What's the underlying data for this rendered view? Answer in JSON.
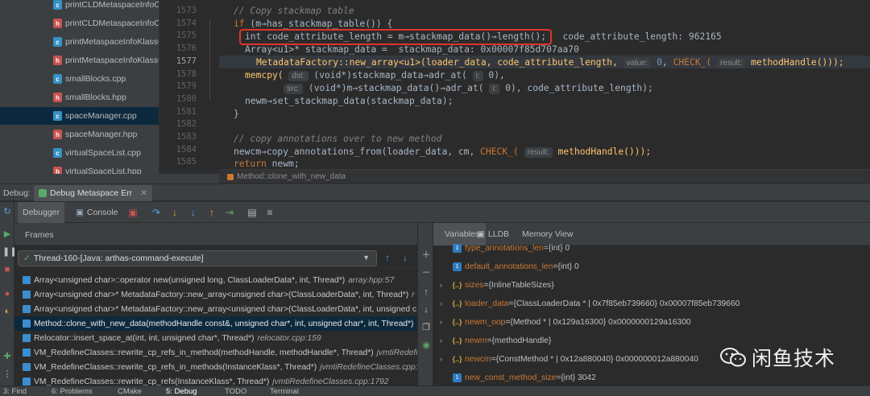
{
  "project_tree": {
    "files": [
      {
        "name": "printCLDMetaspaceInfoCl",
        "kind": "cpp"
      },
      {
        "name": "printCLDMetaspaceInfoCl",
        "kind": "hpp"
      },
      {
        "name": "printMetaspaceInfoKlassC",
        "kind": "cpp"
      },
      {
        "name": "printMetaspaceInfoKlassC",
        "kind": "hpp"
      },
      {
        "name": "smallBlocks.cpp",
        "kind": "cpp"
      },
      {
        "name": "smallBlocks.hpp",
        "kind": "hpp"
      },
      {
        "name": "spaceManager.cpp",
        "kind": "cpp",
        "selected": true
      },
      {
        "name": "spaceManager.hpp",
        "kind": "hpp"
      },
      {
        "name": "virtualSpaceList.cpp",
        "kind": "cpp"
      },
      {
        "name": "virtualSpaceList.hpp",
        "kind": "hpp"
      }
    ]
  },
  "editor": {
    "line_numbers": [
      "1573",
      "1574",
      "1575",
      "1576",
      "1577",
      "1578",
      "1579",
      "1580",
      "1581",
      "1582",
      "1583",
      "1584",
      "1585"
    ],
    "current_line": "1577",
    "code": {
      "l1574": "// Copy stackmap table",
      "l1575_kw": "if",
      "l1575_rest": " (m→has_stackmap_table()) {",
      "l1576_code": "int code_attribute_length = m→stackmap_data()→length();",
      "l1576_inline": "code_attribute_length: 962165",
      "l1577_code": "Array<u1>* stackmap_data =",
      "l1577_inline": "stackmap_data: 0x00007f85d707aa70",
      "l1578_pre": "MetadataFactory::new_array<u1>(loader_data, code_attribute_length,",
      "l1578_hint1": "value:",
      "l1578_zero": "0",
      "l1578_check": "CHECK_(",
      "l1578_hint2": "result:",
      "l1578_post": "methodHandle()));",
      "l1579_fn": "memcpy(",
      "l1579_hint": "dst:",
      "l1579_rest": "(void*)stackmap_data→adr_at(",
      "l1579_hint2": "i:",
      "l1579_end": "0),",
      "l1580_hint": "src:",
      "l1580_rest": "(void*)m→stackmap_data()→adr_at(",
      "l1580_hint2": "i:",
      "l1580_end": "0), code_attribute_length);",
      "l1581": "newm→set_stackmap_data(stackmap_data);",
      "l1582": "}",
      "l1584": "// copy annotations over to new method",
      "l1585_pre": "newcm→copy_annotations_from(loader_data, cm,",
      "l1585_check": "CHECK_(",
      "l1585_hint": "result:",
      "l1585_post": "methodHandle()));",
      "l1586_kw": "return",
      "l1586_rest": " newm;"
    },
    "breadcrumb": "Method::clone_with_new_data"
  },
  "debug": {
    "label": "Debug:",
    "tab": "Debug Metaspace Err",
    "toolbar": {
      "debugger_tab": "Debugger",
      "console_tab": "Console"
    },
    "frames": {
      "title": "Frames",
      "thread": "Thread-160-[Java: arthas-command-execute]",
      "items": [
        {
          "text": "Array<unsigned char>::operator new(unsigned long, ClassLoaderData*, int, Thread*)",
          "file": "array.hpp:57"
        },
        {
          "text": "Array<unsigned char>* MetadataFactory::new_array<unsigned char>(ClassLoaderData*, int, Thread*)",
          "file": "r"
        },
        {
          "text": "Array<unsigned char>* MetadataFactory::new_array<unsigned char>(ClassLoaderData*, int, unsigned c",
          "file": ""
        },
        {
          "text": "Method::clone_with_new_data(methodHandle const&, unsigned char*, int, unsigned char*, int, Thread*)",
          "file": "",
          "selected": true
        },
        {
          "text": "Relocator::insert_space_at(int, int, unsigned char*, Thread*)",
          "file": "relocator.cpp:159"
        },
        {
          "text": "VM_RedefineClasses::rewrite_cp_refs_in_method(methodHandle, methodHandle*, Thread*)",
          "file": "jvmtiRedefine"
        },
        {
          "text": "VM_RedefineClasses::rewrite_cp_refs_in_methods(InstanceKlass*, Thread*)",
          "file": "jvmtiRedefineClasses.cpp:"
        },
        {
          "text": "VM_RedefineClasses::rewrite_cp_refs(InstanceKlass*, Thread*)",
          "file": "jvmtiRedefineClasses.cpp:1792"
        }
      ]
    },
    "variables": {
      "tabs": [
        "Variables",
        "LLDB",
        "Memory View"
      ],
      "items": [
        {
          "arrow": "",
          "icon": "p",
          "name": "type_annotations_len",
          "value": "{int} 0"
        },
        {
          "arrow": "",
          "icon": "p",
          "name": "default_annotations_len",
          "value": "{int} 0"
        },
        {
          "arrow": "›",
          "icon": "s",
          "name": "sizes",
          "value": "{InlineTableSizes}"
        },
        {
          "arrow": "›",
          "icon": "s",
          "name": "loader_data",
          "value": "{ClassLoaderData * | 0x7f85eb739660} 0x00007f85eb739660"
        },
        {
          "arrow": "›",
          "icon": "s",
          "name": "newm_oop",
          "value": "{Method * | 0x129a16300} 0x0000000129a16300"
        },
        {
          "arrow": "›",
          "icon": "s",
          "name": "newm",
          "value": "{methodHandle}"
        },
        {
          "arrow": "›",
          "icon": "s",
          "name": "newcm",
          "value": "{ConstMethod * | 0x12a880040} 0x000000012a880040"
        },
        {
          "arrow": "",
          "icon": "p",
          "name": "new_const_method_size",
          "value": "{int} 3042"
        }
      ]
    }
  },
  "bottom_tabs": [
    "3: Find",
    "6: Problems",
    "CMake",
    "5: Debug",
    "TODO",
    "Terminal"
  ],
  "watermark": "闲鱼技术",
  "colors": {
    "highlight_box": "#e0322c",
    "selection": "#0d293e",
    "keyword": "#cc7832",
    "function": "#ffc66d"
  }
}
